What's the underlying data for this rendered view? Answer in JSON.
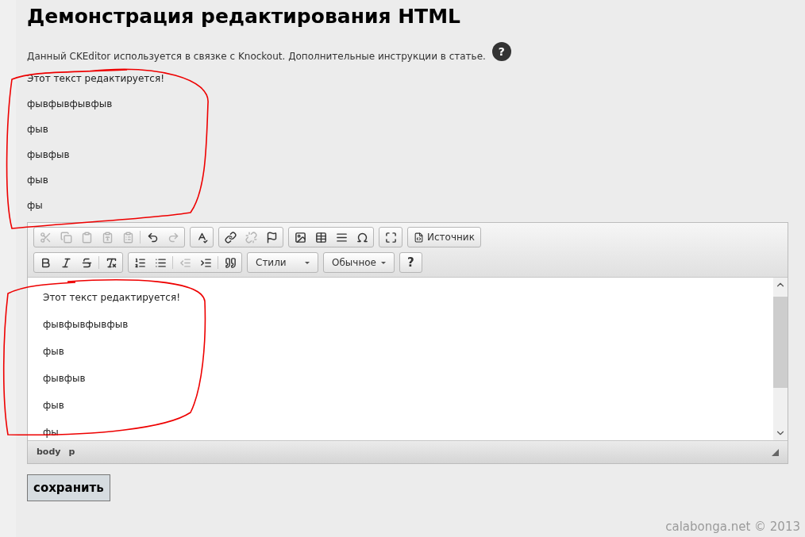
{
  "page": {
    "title": "Демонстрация редактирования HTML",
    "intro": "Данный CKEditor используется в связке с Knockout. Дополнительные инструкции в статье.",
    "help_badge": "?"
  },
  "preview_paragraphs": [
    "Этот текст редактируется!",
    "фывфывфывфыв",
    "фыв",
    "фывфыв",
    "фыв",
    "фы"
  ],
  "editor": {
    "toolbar_rows": [
      [
        {
          "items": [
            {
              "kind": "cut",
              "disabled": true
            },
            {
              "kind": "copy",
              "disabled": true
            },
            {
              "kind": "paste",
              "disabled": true
            },
            {
              "kind": "paste-text",
              "disabled": true
            },
            {
              "kind": "paste-word",
              "disabled": true
            },
            {
              "kind": "sep"
            },
            {
              "kind": "undo",
              "disabled": false
            },
            {
              "kind": "redo",
              "disabled": true
            }
          ]
        },
        {
          "items": [
            {
              "kind": "spellcheck",
              "disabled": false
            }
          ]
        },
        {
          "items": [
            {
              "kind": "link",
              "disabled": false
            },
            {
              "kind": "unlink",
              "disabled": true
            },
            {
              "kind": "anchor",
              "disabled": false
            }
          ]
        },
        {
          "items": [
            {
              "kind": "image",
              "disabled": false
            },
            {
              "kind": "table",
              "disabled": false
            },
            {
              "kind": "rule",
              "disabled": false
            },
            {
              "kind": "omega",
              "disabled": false
            }
          ]
        },
        {
          "items": [
            {
              "kind": "maximize",
              "disabled": false
            }
          ]
        },
        {
          "items": [
            {
              "kind": "source",
              "label": "Источник",
              "disabled": false
            }
          ]
        }
      ],
      [
        {
          "items": [
            {
              "kind": "bold",
              "disabled": false
            },
            {
              "kind": "italic",
              "disabled": false
            },
            {
              "kind": "strike",
              "disabled": false
            },
            {
              "kind": "sep"
            },
            {
              "kind": "clear-format",
              "disabled": false
            }
          ]
        },
        {
          "items": [
            {
              "kind": "ordered-list",
              "disabled": false
            },
            {
              "kind": "bullet-list",
              "disabled": false
            },
            {
              "kind": "sep"
            },
            {
              "kind": "outdent",
              "disabled": true
            },
            {
              "kind": "indent",
              "disabled": false
            },
            {
              "kind": "sep"
            },
            {
              "kind": "quote",
              "disabled": false
            }
          ]
        },
        {
          "kind": "combo",
          "label": "Стили"
        },
        {
          "kind": "combo",
          "label": "Обычное"
        },
        {
          "items": [
            {
              "kind": "help",
              "label": "?",
              "disabled": false
            }
          ]
        }
      ]
    ],
    "paragraphs": [
      "Этот текст редактируется!",
      "фывфывфывфыв",
      "фыв",
      "фывфыв",
      "фыв",
      "фы"
    ],
    "path": [
      "body",
      "p"
    ]
  },
  "save_button": "сохранить",
  "footer": "calabonga.net © 2013"
}
